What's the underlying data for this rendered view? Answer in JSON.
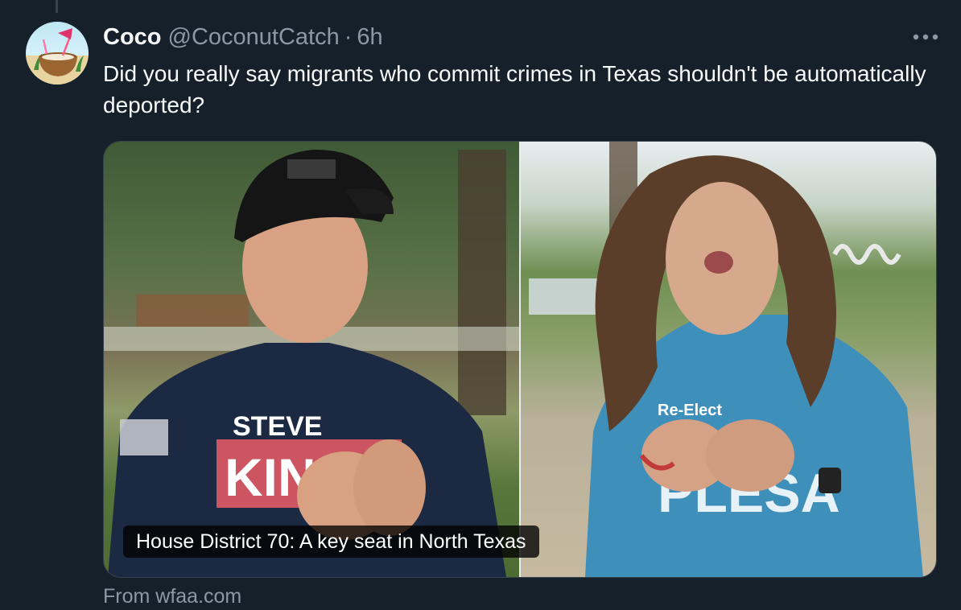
{
  "tweet": {
    "author_name": "Coco",
    "author_handle": "@CoconutCatch",
    "separator": "·",
    "time": "6h",
    "text": "Did you really say migrants who commit crimes in Texas shouldn't be automatically deported?",
    "more_icon": "more-horizontal-icon"
  },
  "media": {
    "caption": "House District 70: A key seat in North Texas",
    "left_shirt_lines": [
      "STEVE",
      "KIN"
    ],
    "right_shirt_lines": [
      "Re-Elect",
      "PLESA"
    ]
  },
  "card": {
    "source": "From wfaa.com"
  },
  "colors": {
    "background": "#15202b",
    "primary_text": "#f7f9f9",
    "secondary_text": "#8b98a5",
    "border": "#38444d"
  }
}
